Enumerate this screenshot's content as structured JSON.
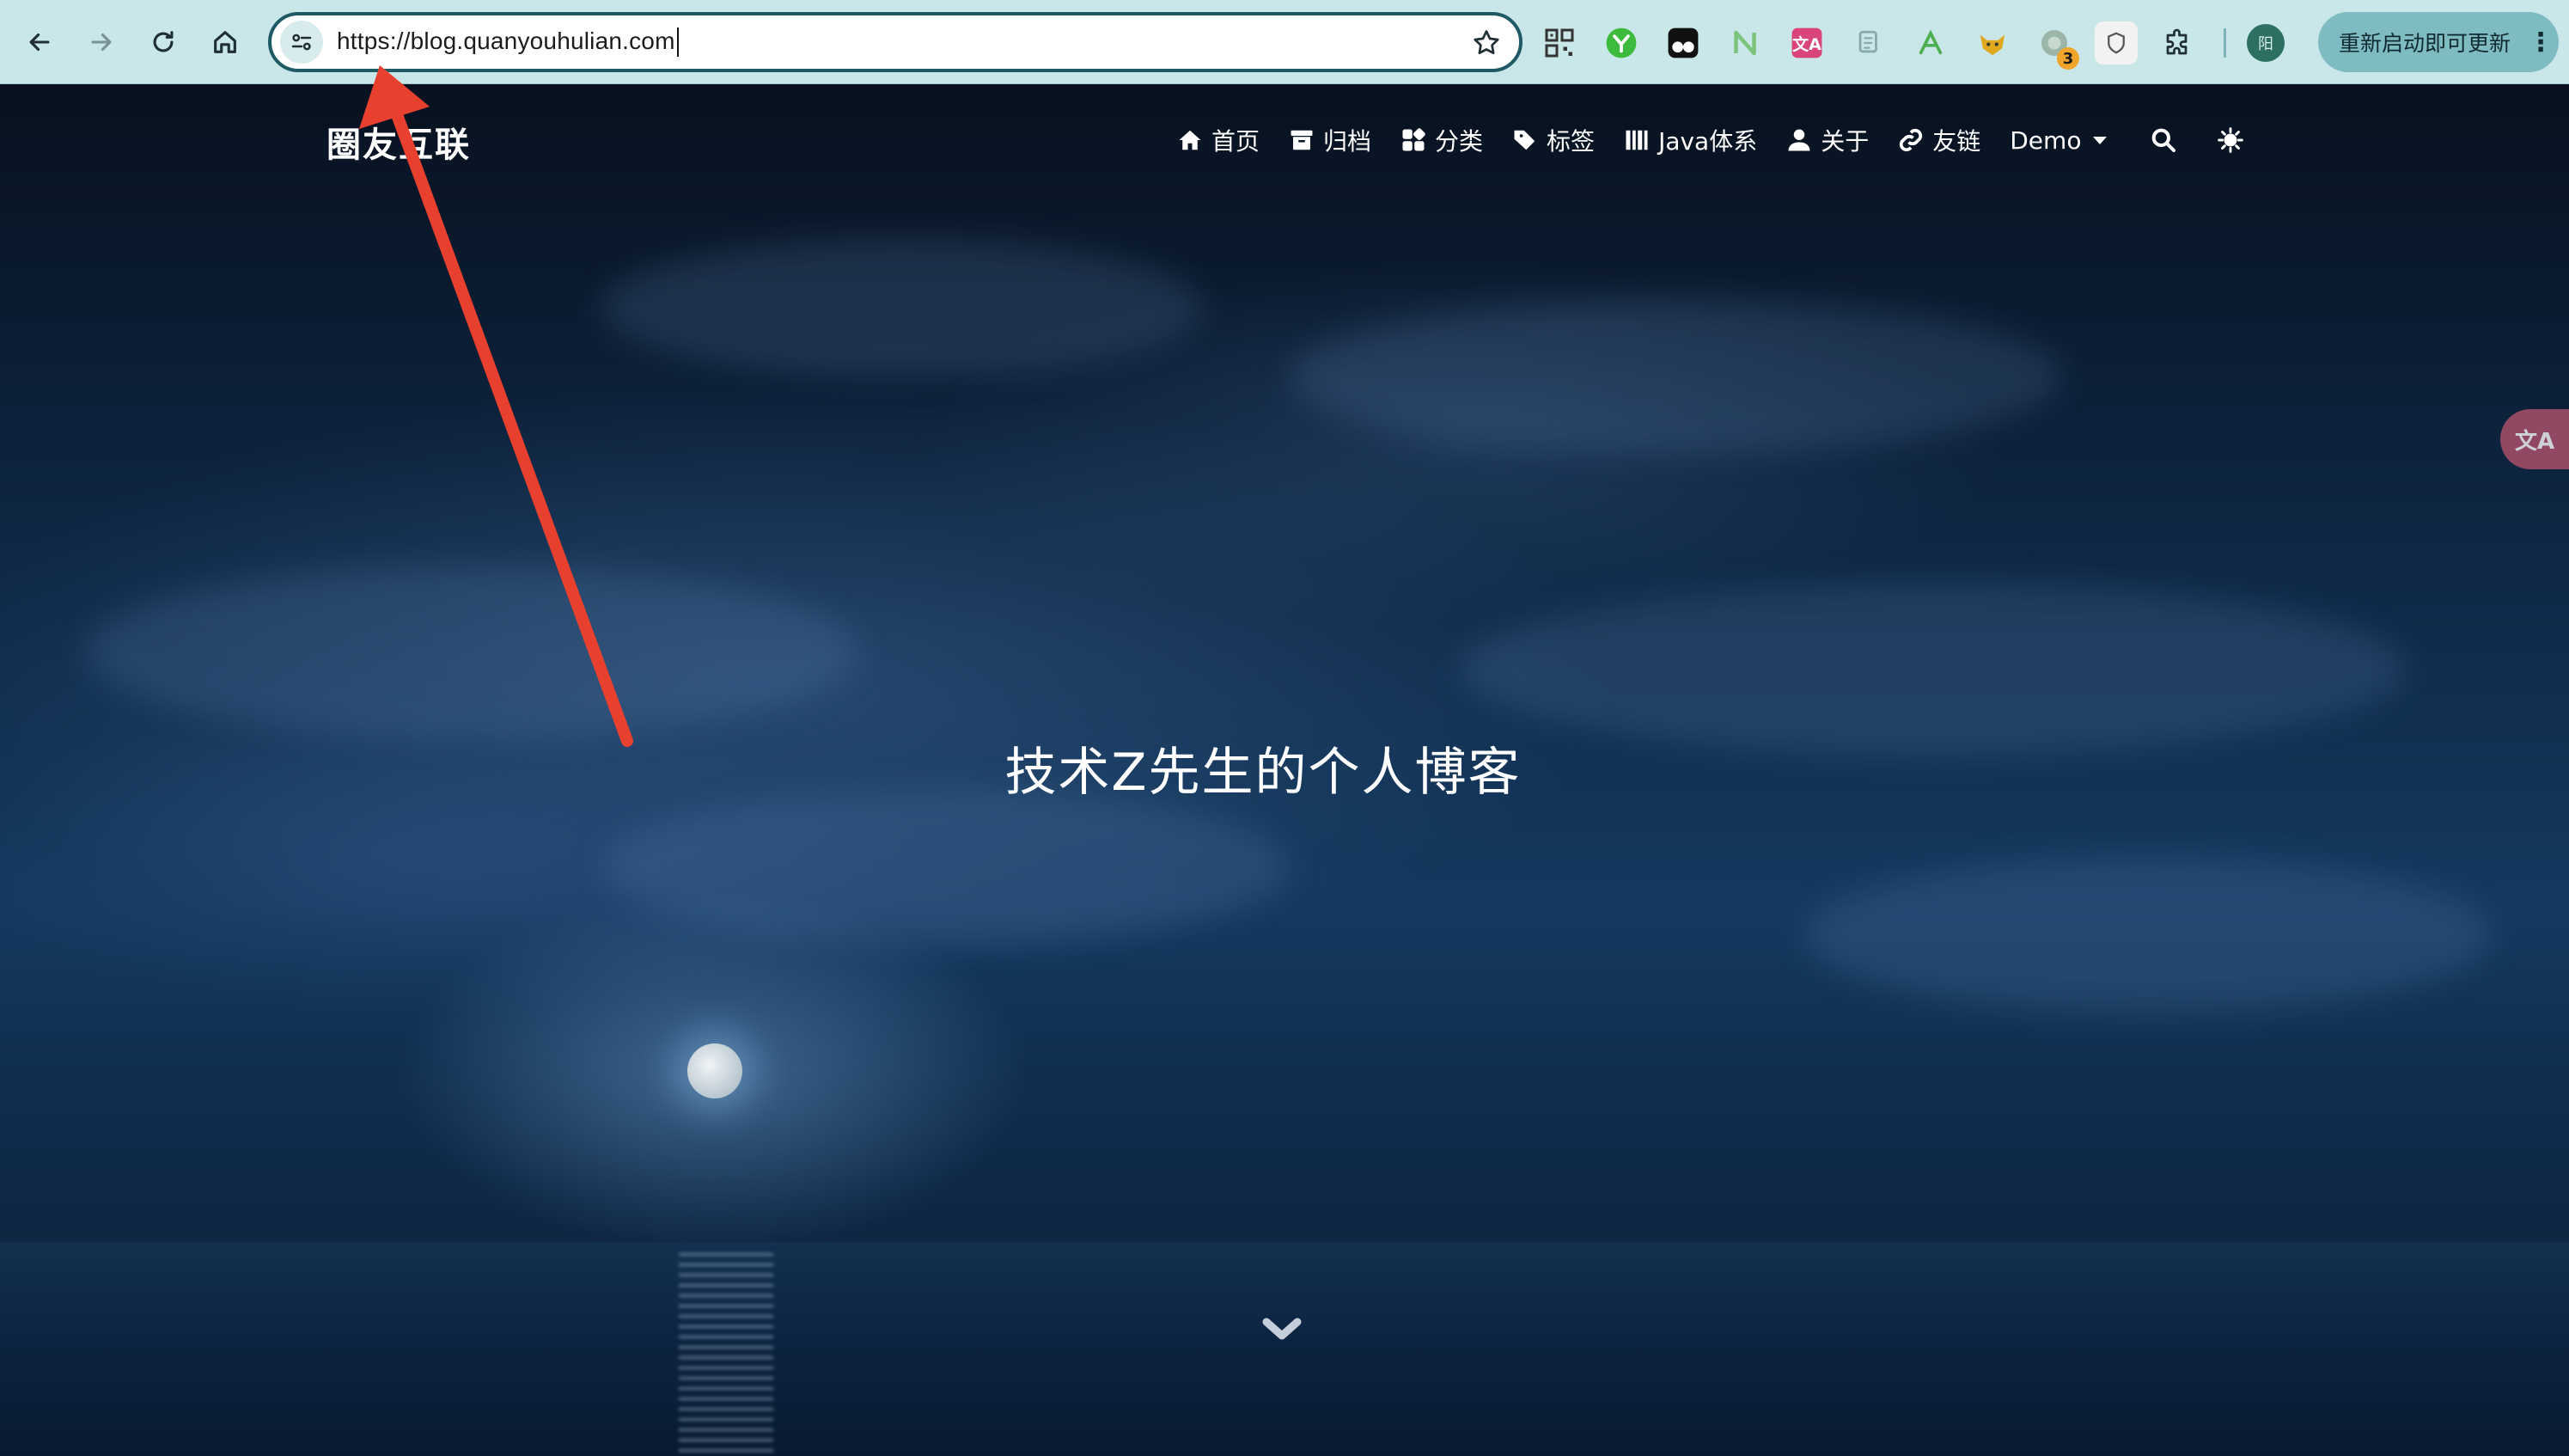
{
  "browser": {
    "url": "https://blog.quanyouhulian.com",
    "update_button_label": "重新启动即可更新",
    "profile_initial": "阳",
    "extensions": [
      {
        "name": "qr-code-extension",
        "label": ""
      },
      {
        "name": "green-y-extension",
        "label": ""
      },
      {
        "name": "tampermonkey-extension",
        "label": ""
      },
      {
        "name": "green-n-extension",
        "label": ""
      },
      {
        "name": "translate-extension",
        "label": ""
      },
      {
        "name": "copy-extension",
        "label": ""
      },
      {
        "name": "green-a-extension",
        "label": ""
      },
      {
        "name": "fox-extension",
        "label": ""
      },
      {
        "name": "badge-extension",
        "label": "3"
      },
      {
        "name": "shield-extension",
        "label": ""
      }
    ]
  },
  "site": {
    "brand": "圈友互联",
    "menu": [
      {
        "label": "首页",
        "icon": "home-icon"
      },
      {
        "label": "归档",
        "icon": "archive-icon"
      },
      {
        "label": "分类",
        "icon": "grid-icon"
      },
      {
        "label": "标签",
        "icon": "tags-icon"
      },
      {
        "label": "Java体系",
        "icon": "books-icon"
      },
      {
        "label": "关于",
        "icon": "user-icon"
      },
      {
        "label": "友链",
        "icon": "link-icon"
      },
      {
        "label": "Demo",
        "icon": "dropdown-caret"
      }
    ],
    "hero_title": "技术Z先生的个人博客",
    "translate_fab": "文A"
  },
  "colors": {
    "browser_toolbar": "#c9e6e8",
    "omnibox_border": "#1d5a63",
    "annotation_arrow": "#e8402e",
    "update_button": "#7fbcc2"
  }
}
